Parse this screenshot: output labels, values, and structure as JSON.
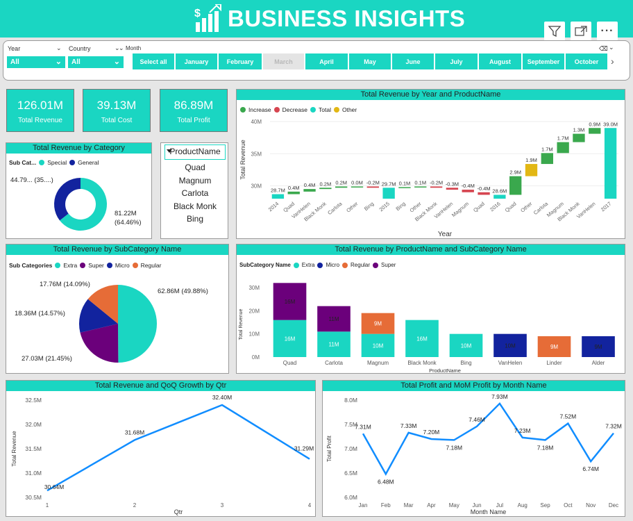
{
  "header": {
    "title": "BUSINESS INSIGHTS"
  },
  "filters": {
    "year": {
      "label": "Year",
      "value": "All"
    },
    "country": {
      "label": "Country",
      "value": "All"
    },
    "month": {
      "label": "Month",
      "select_all": "Select all",
      "items": [
        "January",
        "February",
        "March",
        "April",
        "May",
        "June",
        "July",
        "August",
        "September",
        "October"
      ]
    }
  },
  "kpis": [
    {
      "value": "126.01M",
      "label": "Total Revenue"
    },
    {
      "value": "39.13M",
      "label": "Total Cost"
    },
    {
      "value": "86.89M",
      "label": "Total Profit"
    }
  ],
  "colors": {
    "teal": "#1ad6c2",
    "navy": "#12239e",
    "purple": "#6b007b",
    "orange": "#e66c37",
    "increase": "#3aa84d",
    "decrease": "#d64550",
    "other": "#e2b714"
  },
  "product_slicer": {
    "header": "ProductName",
    "items": [
      "Quad",
      "Magnum",
      "Carlota",
      "Black Monk",
      "Bing"
    ]
  },
  "chart_data": [
    {
      "id": "waterfall",
      "type": "bar",
      "title": "Total Revenue by Year and ProductName",
      "xlabel": "Year",
      "ylabel": "Total Revenue",
      "legend": [
        "Increase",
        "Decrease",
        "Total",
        "Other"
      ],
      "legend_placement": "top-left",
      "yticks": [
        "30M",
        "35M",
        "40M"
      ],
      "ylim": [
        28.0,
        40.0
      ],
      "steps": [
        {
          "cat": "2014",
          "kind": "total",
          "value": 28.7,
          "label": "28.7M"
        },
        {
          "cat": "Quad",
          "kind": "inc",
          "value": 0.4,
          "label": "0.4M"
        },
        {
          "cat": "VanHelen",
          "kind": "inc",
          "value": 0.4,
          "label": "0.4M"
        },
        {
          "cat": "Black Monk",
          "kind": "inc",
          "value": 0.2,
          "label": "0.2M"
        },
        {
          "cat": "Carlota",
          "kind": "inc",
          "value": 0.2,
          "label": "0.2M"
        },
        {
          "cat": "Other",
          "kind": "inc",
          "value": 0.0,
          "label": "0.0M"
        },
        {
          "cat": "Bing",
          "kind": "dec",
          "value": -0.2,
          "label": "-0.2M"
        },
        {
          "cat": "2015",
          "kind": "total",
          "value": 29.7,
          "label": "29.7M"
        },
        {
          "cat": "Bing",
          "kind": "inc",
          "value": 0.1,
          "label": "0.1M"
        },
        {
          "cat": "Other",
          "kind": "inc",
          "value": 0.1,
          "label": "0.1M"
        },
        {
          "cat": "Black Monk",
          "kind": "dec",
          "value": -0.2,
          "label": "-0.2M"
        },
        {
          "cat": "VanHelen",
          "kind": "dec",
          "value": -0.3,
          "label": "-0.3M"
        },
        {
          "cat": "Magnum",
          "kind": "dec",
          "value": -0.4,
          "label": "-0.4M"
        },
        {
          "cat": "Quad",
          "kind": "dec",
          "value": -0.4,
          "label": "-0.4M"
        },
        {
          "cat": "2016",
          "kind": "total",
          "value": 28.6,
          "label": "28.6M"
        },
        {
          "cat": "Quad",
          "kind": "inc",
          "value": 2.9,
          "label": "2.9M"
        },
        {
          "cat": "Other",
          "kind": "other",
          "value": 1.9,
          "label": "1.9M"
        },
        {
          "cat": "Carlota",
          "kind": "inc",
          "value": 1.7,
          "label": "1.7M"
        },
        {
          "cat": "Magnum",
          "kind": "inc",
          "value": 1.7,
          "label": "1.7M"
        },
        {
          "cat": "Black Monk",
          "kind": "inc",
          "value": 1.3,
          "label": "1.3M"
        },
        {
          "cat": "VanHelen",
          "kind": "inc",
          "value": 0.9,
          "label": "0.9M"
        },
        {
          "cat": "2017",
          "kind": "total",
          "value": 39.0,
          "label": "39.0M"
        }
      ]
    },
    {
      "id": "category_donut",
      "type": "pie",
      "title": "Total Revenue by Category",
      "legend_title": "Sub Cat...",
      "legend_placement": "top-left",
      "slices": [
        {
          "name": "Special",
          "value": 81.22,
          "label": "81.22M",
          "pct": "(64.46%)"
        },
        {
          "name": "General",
          "value": 44.79,
          "label": "44.79...",
          "pct": "(35....)"
        }
      ]
    },
    {
      "id": "subcat_pie",
      "type": "pie",
      "title": "Total Revenue by SubCategory Name",
      "legend_title": "Sub Categories",
      "legend_placement": "top-left",
      "slices": [
        {
          "name": "Extra",
          "value": 62.86,
          "label": "62.86M (49.88%)"
        },
        {
          "name": "Super",
          "value": 27.03,
          "label": "27.03M (21.45%)"
        },
        {
          "name": "Micro",
          "value": 18.36,
          "label": "18.36M (14.57%)"
        },
        {
          "name": "Regular",
          "value": 17.76,
          "label": "17.76M (14.09%)"
        }
      ]
    },
    {
      "id": "stacked",
      "type": "bar",
      "title": "Total Revenue by ProductName and SubCategory Name",
      "xlabel": "ProductName",
      "ylabel": "Total Revenue",
      "legend_title": "SubCategory Name",
      "legend": [
        "Extra",
        "Micro",
        "Regular",
        "Super"
      ],
      "legend_placement": "top-left",
      "ylim": [
        0,
        30
      ],
      "yticks": [
        "0M",
        "10M",
        "20M",
        "30M"
      ],
      "categories": [
        "Quad",
        "Carlota",
        "Magnum",
        "Black Monk",
        "Bing",
        "VanHelen",
        "Linder",
        "Alder"
      ],
      "series": [
        {
          "name": "Extra",
          "values": [
            16,
            11,
            10,
            16,
            10,
            0,
            0,
            0
          ],
          "labels": [
            "16M",
            "11M",
            "10M",
            "16M",
            "10M",
            "",
            "",
            ""
          ]
        },
        {
          "name": "Micro",
          "values": [
            0,
            0,
            0,
            0,
            0,
            10,
            0,
            9
          ],
          "labels": [
            "",
            "",
            "",
            "",
            "",
            "10M",
            "",
            "9M"
          ]
        },
        {
          "name": "Regular",
          "values": [
            0,
            0,
            9,
            0,
            0,
            0,
            9,
            0
          ],
          "labels": [
            "",
            "",
            "9M",
            "",
            "",
            "",
            "9M",
            ""
          ]
        },
        {
          "name": "Super",
          "values": [
            16,
            11,
            0,
            0,
            0,
            0,
            0,
            0
          ],
          "labels": [
            "16M",
            "11M",
            "",
            "",
            "",
            "",
            "",
            ""
          ]
        }
      ]
    },
    {
      "id": "qtr_line",
      "type": "line",
      "title": "Total Revenue and QoQ Growth by Qtr",
      "xlabel": "Qtr",
      "ylabel": "Total Revenue",
      "x": [
        "1",
        "2",
        "3",
        "4"
      ],
      "y": [
        30.64,
        31.68,
        32.4,
        31.29
      ],
      "labels": [
        "30.64M",
        "31.68M",
        "32.40M",
        "31.29M"
      ],
      "ylim": [
        30.5,
        32.5
      ],
      "yticks": [
        "30.5M",
        "31.0M",
        "31.5M",
        "32.0M",
        "32.5M"
      ]
    },
    {
      "id": "month_line",
      "type": "line",
      "title": "Total Profit and MoM Profit by Month Name",
      "xlabel": "Month Name",
      "ylabel": "Total Profit",
      "x": [
        "Jan",
        "Feb",
        "Mar",
        "Apr",
        "May",
        "Jun",
        "Jul",
        "Aug",
        "Sep",
        "Oct",
        "Nov",
        "Dec"
      ],
      "y": [
        7.31,
        6.48,
        7.33,
        7.2,
        7.18,
        7.46,
        7.93,
        7.23,
        7.18,
        7.52,
        6.74,
        7.32
      ],
      "labels": [
        "7.31M",
        "6.48M",
        "7.33M",
        "7.20M",
        "7.18M",
        "7.46M",
        "7.93M",
        "7.23M",
        "7.18M",
        "7.52M",
        "6.74M",
        "7.32M"
      ],
      "ylim": [
        6.0,
        8.0
      ],
      "yticks": [
        "6.0M",
        "6.5M",
        "7.0M",
        "7.5M",
        "8.0M"
      ]
    }
  ]
}
